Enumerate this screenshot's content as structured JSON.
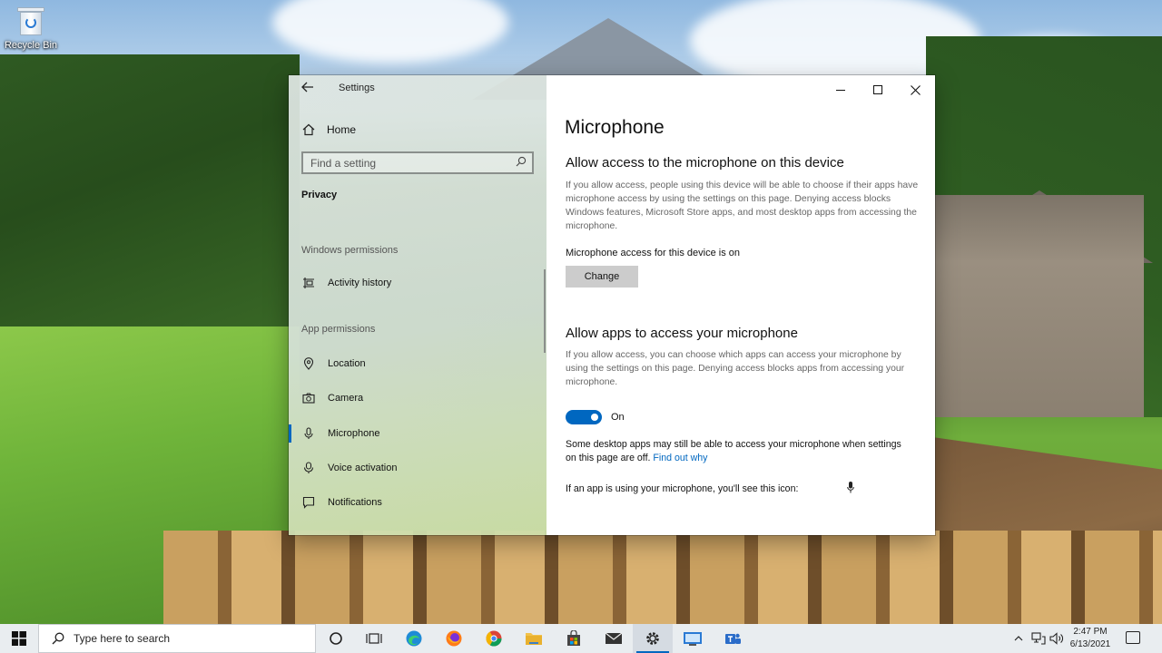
{
  "desktop": {
    "recycle_bin_label": "Recycle Bin"
  },
  "window": {
    "title": "Settings",
    "controls": {
      "minimize": "minimize-icon",
      "maximize": "maximize-icon",
      "close": "close-icon"
    }
  },
  "nav": {
    "home_label": "Home",
    "search_placeholder": "Find a setting",
    "section_label": "Privacy",
    "groups": [
      {
        "header": "Windows permissions",
        "items": [
          {
            "label": "Activity history",
            "icon": "activity-history-icon"
          }
        ]
      },
      {
        "header": "App permissions",
        "items": [
          {
            "label": "Location",
            "icon": "location-icon"
          },
          {
            "label": "Camera",
            "icon": "camera-icon"
          },
          {
            "label": "Microphone",
            "icon": "microphone-icon",
            "active": true
          },
          {
            "label": "Voice activation",
            "icon": "voice-activation-icon"
          },
          {
            "label": "Notifications",
            "icon": "notifications-icon"
          }
        ]
      }
    ]
  },
  "content": {
    "page_title": "Microphone",
    "device_section": {
      "heading": "Allow access to the microphone on this device",
      "description": "If you allow access, people using this device will be able to choose if their apps have microphone access by using the settings on this page. Denying access blocks Windows features, Microsoft Store apps, and most desktop apps from accessing the microphone.",
      "status": "Microphone access for this device is on",
      "button_label": "Change"
    },
    "apps_section": {
      "heading": "Allow apps to access your microphone",
      "description": "If you allow access, you can choose which apps can access your microphone by using the settings on this page. Denying access blocks apps from accessing your microphone.",
      "toggle_state_label": "On",
      "toggle_on": true,
      "note_text": "Some desktop apps may still be able to access your microphone when settings on this page are off. ",
      "note_link": "Find out why",
      "icon_note": "If an app is using your microphone, you'll see this icon:"
    },
    "accent_color": "#0067c0"
  },
  "taskbar": {
    "search_placeholder": "Type here to search",
    "apps": [
      "cortana-icon",
      "task-view-icon",
      "edge-icon",
      "firefox-icon",
      "chrome-icon",
      "file-explorer-icon",
      "store-icon",
      "mail-icon",
      "settings-icon",
      "remote-desktop-icon",
      "teams-icon"
    ],
    "active_app": "settings-icon",
    "clock_time": "2:47 PM",
    "clock_date": "6/13/2021"
  }
}
